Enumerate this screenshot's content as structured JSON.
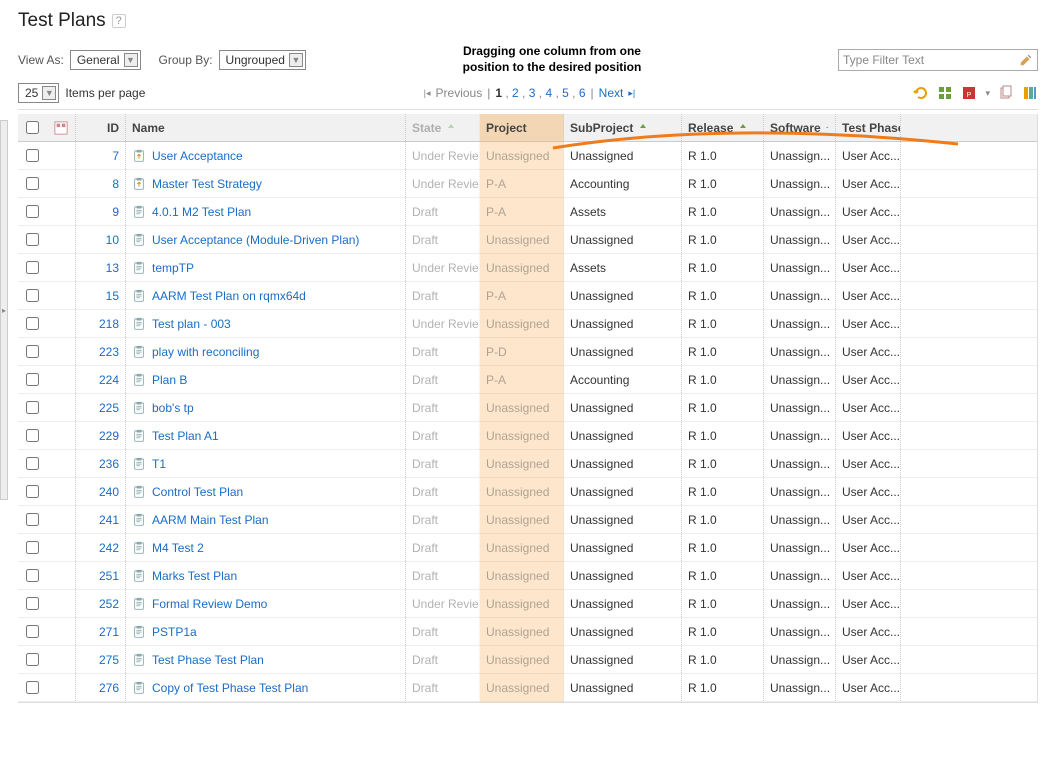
{
  "page_title": "Test Plans",
  "view_as_label": "View As:",
  "view_as_value": "General",
  "group_by_label": "Group By:",
  "group_by_value": "Ungrouped",
  "annotation_text": "Dragging one column from one position to the desired position",
  "filter_placeholder": "Type Filter Text",
  "items_per_page_value": "25",
  "items_per_page_label": "Items per page",
  "pagination": {
    "prev": "Previous",
    "pages": [
      "1",
      "2",
      "3",
      "4",
      "5",
      "6"
    ],
    "current": "1",
    "next": "Next"
  },
  "columns": {
    "id": "ID",
    "name": "Name",
    "state": "State",
    "project": "Project",
    "subproject": "SubProject",
    "release": "Release",
    "software": "Software",
    "testphase": "Test Phase"
  },
  "rows": [
    {
      "id": "7",
      "name": "User Acceptance",
      "state": "Under Review",
      "project": "Unassigned",
      "subproject": "Unassigned",
      "release": "R 1.0",
      "software": "Unassign...",
      "testphase": "User Acc...",
      "icon": "clipboard-up"
    },
    {
      "id": "8",
      "name": "Master Test Strategy",
      "state": "Under Review",
      "project": "P-A",
      "subproject": "Accounting",
      "release": "R 1.0",
      "software": "Unassign...",
      "testphase": "User Acc...",
      "icon": "clipboard-up"
    },
    {
      "id": "9",
      "name": "4.0.1 M2 Test Plan",
      "state": "Draft",
      "project": "P-A",
      "subproject": "Assets",
      "release": "R 1.0",
      "software": "Unassign...",
      "testphase": "User Acc...",
      "icon": "clipboard"
    },
    {
      "id": "10",
      "name": "User Acceptance (Module-Driven Plan)",
      "state": "Draft",
      "project": "Unassigned",
      "subproject": "Unassigned",
      "release": "R 1.0",
      "software": "Unassign...",
      "testphase": "User Acc...",
      "icon": "clipboard"
    },
    {
      "id": "13",
      "name": "tempTP",
      "state": "Under Review",
      "project": "Unassigned",
      "subproject": "Assets",
      "release": "R 1.0",
      "software": "Unassign...",
      "testphase": "User Acc...",
      "icon": "clipboard"
    },
    {
      "id": "15",
      "name": "AARM Test Plan on rqmx64d",
      "state": "Draft",
      "project": "P-A",
      "subproject": "Unassigned",
      "release": "R 1.0",
      "software": "Unassign...",
      "testphase": "User Acc...",
      "icon": "clipboard"
    },
    {
      "id": "218",
      "name": "Test plan - 003",
      "state": "Under Review",
      "project": "Unassigned",
      "subproject": "Unassigned",
      "release": "R 1.0",
      "software": "Unassign...",
      "testphase": "User Acc...",
      "icon": "clipboard"
    },
    {
      "id": "223",
      "name": "play with reconciling",
      "state": "Draft",
      "project": "P-D",
      "subproject": "Unassigned",
      "release": "R 1.0",
      "software": "Unassign...",
      "testphase": "User Acc...",
      "icon": "clipboard"
    },
    {
      "id": "224",
      "name": "Plan B",
      "state": "Draft",
      "project": "P-A",
      "subproject": "Accounting",
      "release": "R 1.0",
      "software": "Unassign...",
      "testphase": "User Acc...",
      "icon": "clipboard"
    },
    {
      "id": "225",
      "name": "bob's tp",
      "state": "Draft",
      "project": "Unassigned",
      "subproject": "Unassigned",
      "release": "R 1.0",
      "software": "Unassign...",
      "testphase": "User Acc...",
      "icon": "clipboard"
    },
    {
      "id": "229",
      "name": "Test Plan A1",
      "state": "Draft",
      "project": "Unassigned",
      "subproject": "Unassigned",
      "release": "R 1.0",
      "software": "Unassign...",
      "testphase": "User Acc...",
      "icon": "clipboard"
    },
    {
      "id": "236",
      "name": "T1",
      "state": "Draft",
      "project": "Unassigned",
      "subproject": "Unassigned",
      "release": "R 1.0",
      "software": "Unassign...",
      "testphase": "User Acc...",
      "icon": "clipboard"
    },
    {
      "id": "240",
      "name": "Control Test Plan",
      "state": "Draft",
      "project": "Unassigned",
      "subproject": "Unassigned",
      "release": "R 1.0",
      "software": "Unassign...",
      "testphase": "User Acc...",
      "icon": "clipboard"
    },
    {
      "id": "241",
      "name": "AARM Main Test Plan",
      "state": "Draft",
      "project": "Unassigned",
      "subproject": "Unassigned",
      "release": "R 1.0",
      "software": "Unassign...",
      "testphase": "User Acc...",
      "icon": "clipboard"
    },
    {
      "id": "242",
      "name": "M4 Test 2",
      "state": "Draft",
      "project": "Unassigned",
      "subproject": "Unassigned",
      "release": "R 1.0",
      "software": "Unassign...",
      "testphase": "User Acc...",
      "icon": "clipboard"
    },
    {
      "id": "251",
      "name": "Marks Test Plan",
      "state": "Draft",
      "project": "Unassigned",
      "subproject": "Unassigned",
      "release": "R 1.0",
      "software": "Unassign...",
      "testphase": "User Acc...",
      "icon": "clipboard"
    },
    {
      "id": "252",
      "name": "Formal Review Demo",
      "state": "Under Review",
      "project": "Unassigned",
      "subproject": "Unassigned",
      "release": "R 1.0",
      "software": "Unassign...",
      "testphase": "User Acc...",
      "icon": "clipboard"
    },
    {
      "id": "271",
      "name": "PSTP1a",
      "state": "Draft",
      "project": "Unassigned",
      "subproject": "Unassigned",
      "release": "R 1.0",
      "software": "Unassign...",
      "testphase": "User Acc...",
      "icon": "clipboard"
    },
    {
      "id": "275",
      "name": "Test Phase Test Plan",
      "state": "Draft",
      "project": "Unassigned",
      "subproject": "Unassigned",
      "release": "R 1.0",
      "software": "Unassign...",
      "testphase": "User Acc...",
      "icon": "clipboard"
    },
    {
      "id": "276",
      "name": "Copy of Test Phase Test Plan",
      "state": "Draft",
      "project": "Unassigned",
      "subproject": "Unassigned",
      "release": "R 1.0",
      "software": "Unassign...",
      "testphase": "User Acc...",
      "icon": "clipboard"
    }
  ]
}
